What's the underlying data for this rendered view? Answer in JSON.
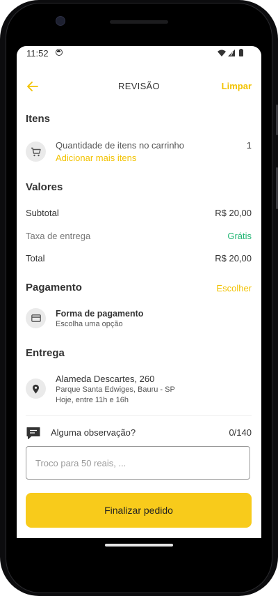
{
  "status_bar": {
    "time": "11:52"
  },
  "header": {
    "title": "REVISÃO",
    "clear_label": "Limpar"
  },
  "items_section": {
    "title": "Itens",
    "quantity_label": "Quantidade de itens no carrinho",
    "quantity_value": "1",
    "add_more_label": "Adicionar mais itens"
  },
  "values_section": {
    "title": "Valores",
    "subtotal_label": "Subtotal",
    "subtotal_value": "R$ 20,00",
    "delivery_fee_label": "Taxa de entrega",
    "delivery_fee_value": "Grátis",
    "total_label": "Total",
    "total_value": "R$ 20,00"
  },
  "payment_section": {
    "title": "Pagamento",
    "choose_label": "Escolher",
    "method_title": "Forma de pagamento",
    "method_subtitle": "Escolha uma opção"
  },
  "delivery_section": {
    "title": "Entrega",
    "address_line1": "Alameda Descartes, 260",
    "address_line2": "Parque Santa Edwiges, Bauru - SP",
    "delivery_time": "Hoje, entre 11h e 16h"
  },
  "observation": {
    "label": "Alguma observação?",
    "counter": "0/140",
    "placeholder": "Troco para 50 reais, ..."
  },
  "finish_button": {
    "label": "Finalizar pedido"
  },
  "colors": {
    "accent": "#F2C200",
    "button": "#F8CB1B",
    "free": "#21B573"
  },
  "icons": {
    "back": "arrow-left",
    "cart": "shopping-cart",
    "payment": "credit-card",
    "location": "map-pin",
    "observation": "chat-bubble"
  }
}
